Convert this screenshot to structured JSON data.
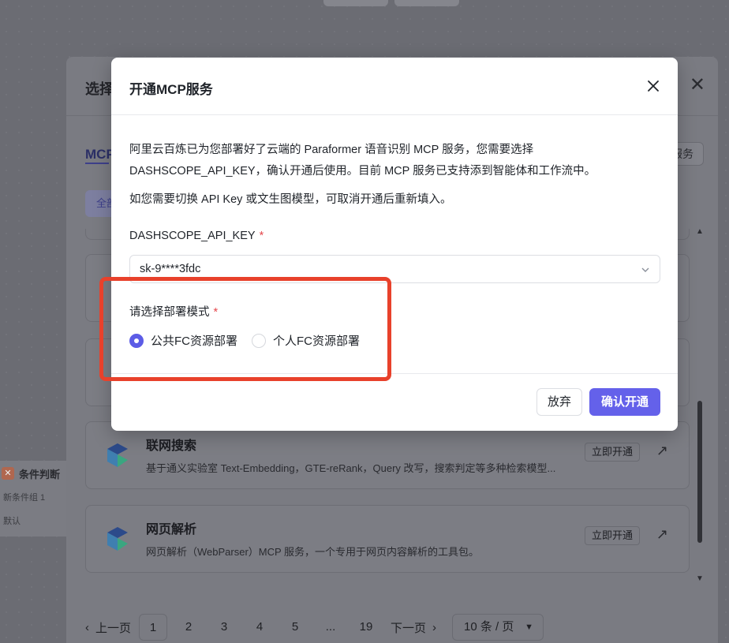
{
  "background": {
    "node": {
      "title": "条件判断",
      "line1": "新条件组 1",
      "line2": "默认"
    }
  },
  "selector_modal": {
    "title": "选择",
    "tab": "MCP",
    "filter_pill": "全部",
    "right_button": "服务",
    "cards": [
      {
        "title": "联网搜索",
        "desc": "基于通义实验室 Text-Embedding，GTE-reRank，Query 改写，搜索判定等多种检索模型...",
        "action": "立即开通"
      },
      {
        "title": "网页解析",
        "desc": "网页解析（WebParser）MCP 服务，一个专用于网页内容解析的工具包。",
        "action": "立即开通"
      }
    ],
    "pagination": {
      "prev": "上一页",
      "next": "下一页",
      "pages": [
        "1",
        "2",
        "3",
        "4",
        "5",
        "...",
        "19"
      ],
      "current": "1",
      "page_size": "10 条 / 页"
    }
  },
  "dialog": {
    "title": "开通MCP服务",
    "description": "阿里云百炼已为您部署好了云端的 Paraformer 语音识别 MCP 服务，您需要选择 DASHSCOPE_API_KEY，确认开通后使用。目前 MCP 服务已支持添到智能体和工作流中。",
    "hint": "如您需要切换 API Key 或文生图模型，可取消开通后重新填入。",
    "api_key_label": "DASHSCOPE_API_KEY",
    "required_mark": "*",
    "api_key_value": "sk-9****3fdc",
    "deploy_mode_label": "请选择部署模式",
    "deploy_options": [
      "公共FC资源部署",
      "个人FC资源部署"
    ],
    "selected_option": "公共FC资源部署",
    "cancel_label": "放弃",
    "confirm_label": "确认开通"
  },
  "colors": {
    "primary": "#6461ea",
    "required": "#e5484d",
    "annotation": "#e8412b"
  }
}
